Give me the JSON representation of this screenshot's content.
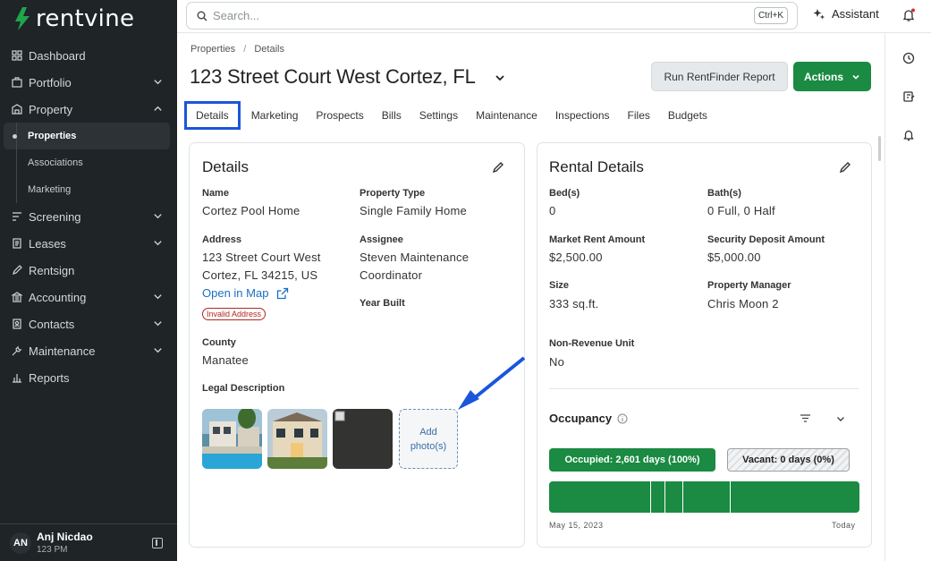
{
  "app": {
    "logo_text": "rentvine"
  },
  "sidebar": {
    "items": [
      {
        "label": "Dashboard",
        "icon": "grid-icon"
      },
      {
        "label": "Portfolio",
        "icon": "briefcase-icon"
      },
      {
        "label": "Property",
        "icon": "building-icon"
      },
      {
        "label": "Screening",
        "icon": "filter-icon"
      },
      {
        "label": "Leases",
        "icon": "document-icon"
      },
      {
        "label": "Rentsign",
        "icon": "pen-icon"
      },
      {
        "label": "Accounting",
        "icon": "bank-icon"
      },
      {
        "label": "Contacts",
        "icon": "address-book-icon"
      },
      {
        "label": "Maintenance",
        "icon": "wrench-icon"
      },
      {
        "label": "Reports",
        "icon": "bar-chart-icon"
      }
    ],
    "property_sub": [
      "Properties",
      "Associations",
      "Marketing"
    ],
    "user": {
      "initials": "AN",
      "name": "Anj Nicdao",
      "sub": "123 PM"
    }
  },
  "topbar": {
    "search_placeholder": "Search...",
    "shortcut": "Ctrl+K",
    "assistant_label": "Assistant",
    "notification_dot_color": "#d32f2f"
  },
  "breadcrumb": [
    "Properties",
    "/",
    "Details"
  ],
  "page": {
    "title": "123 Street Court West Cortez, FL",
    "rentfinder_button": "Run RentFinder Report",
    "actions_button": "Actions",
    "accent_color": "#1b8a42"
  },
  "tabs": [
    "Details",
    "Marketing",
    "Prospects",
    "Bills",
    "Settings",
    "Maintenance",
    "Inspections",
    "Files",
    "Budgets"
  ],
  "details": {
    "title": "Details",
    "name_label": "Name",
    "name_value": "Cortez Pool Home",
    "type_label": "Property Type",
    "type_value": "Single Family Home",
    "address_label": "Address",
    "address_line1": "123 Street Court West",
    "address_line2": "Cortez, FL 34215, US",
    "map_link": "Open in Map",
    "invalid_badge": "Invalid Address",
    "assignee_label": "Assignee",
    "assignee_line1": "Steven Maintenance",
    "assignee_line2": "Coordinator",
    "year_label": "Year Built",
    "county_label": "County",
    "county_value": "Manatee",
    "legal_label": "Legal Description",
    "add_photo_line1": "Add",
    "add_photo_line2": "photo(s)"
  },
  "rental": {
    "title": "Rental Details",
    "beds_label": "Bed(s)",
    "beds_value": "0",
    "baths_label": "Bath(s)",
    "baths_value": "0 Full, 0 Half",
    "market_label": "Market Rent Amount",
    "market_value": "$2,500.00",
    "deposit_label": "Security Deposit Amount",
    "deposit_value": "$5,000.00",
    "size_label": "Size",
    "size_value": "333 sq.ft.",
    "manager_label": "Property Manager",
    "manager_value": "Chris Moon 2",
    "nonrev_label": "Non-Revenue Unit",
    "nonrev_value": "No"
  },
  "occupancy": {
    "title": "Occupancy",
    "occupied_pill": "Occupied: 2,601 days (100%)",
    "vacant_pill": "Vacant: 0 days (0%)",
    "occupied_fraction": 1.0,
    "start_date": "May 15, 2023",
    "end_label": "Today"
  }
}
